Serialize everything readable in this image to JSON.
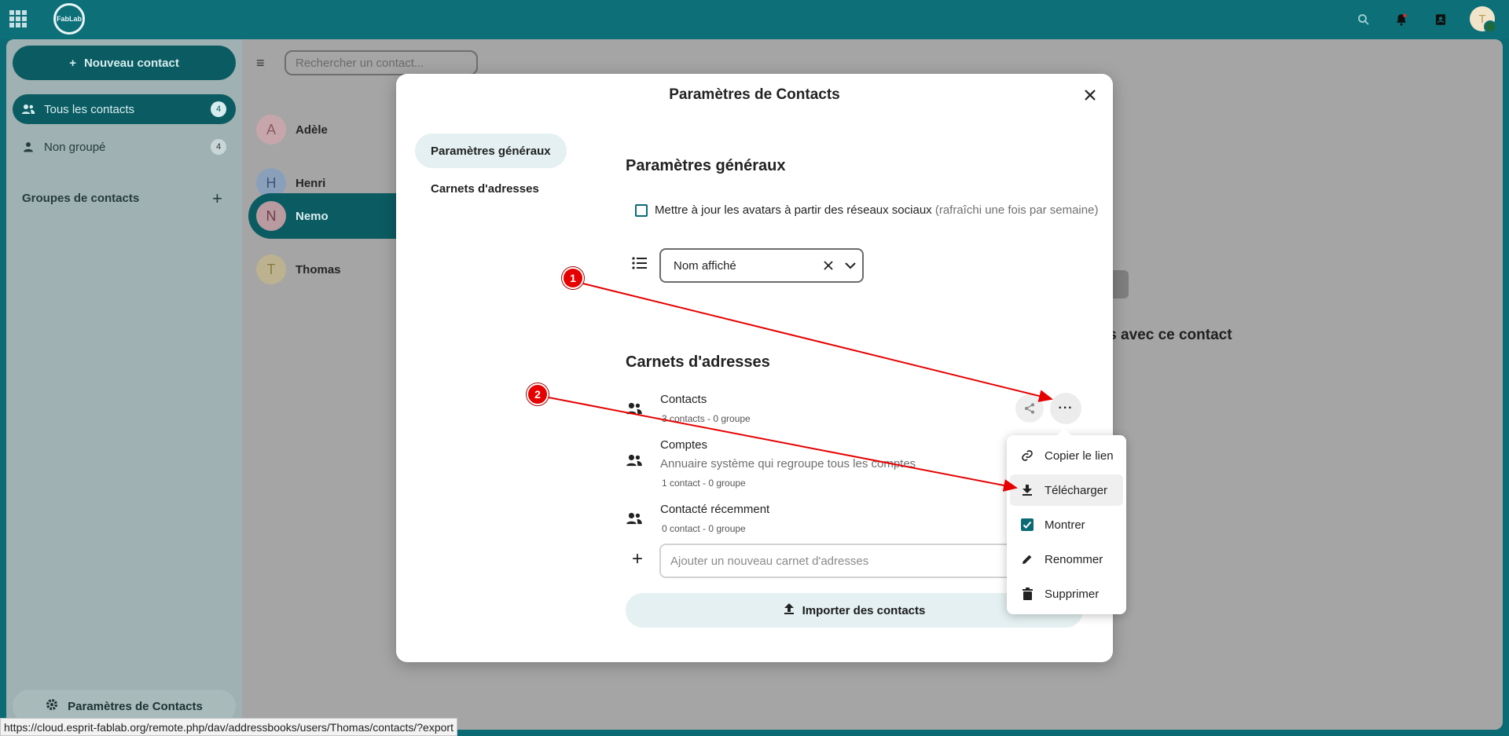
{
  "topbar": {
    "logo_text": "FabLab",
    "user_initial": "T",
    "icons": [
      "apps-icon",
      "search-icon",
      "notifications-icon",
      "contacts-icon"
    ]
  },
  "nav": {
    "new_contact_label": "Nouveau contact",
    "items": [
      {
        "label": "Tous les contacts",
        "count": "4",
        "active": true
      },
      {
        "label": "Non groupé",
        "count": "4",
        "active": false
      }
    ],
    "groups_heading": "Groupes de contacts",
    "footer_label": "Paramètres de Contacts"
  },
  "list": {
    "search_placeholder": "Rechercher un contact...",
    "contacts": [
      {
        "initial": "A",
        "name": "Adèle",
        "bg": "#d8b3b8",
        "fg": "#8b5a63"
      },
      {
        "initial": "H",
        "name": "Henri",
        "bg": "#8fa6c2",
        "fg": "#3d5576"
      },
      {
        "initial": "N",
        "name": "Nemo",
        "bg": "#c9a4ab",
        "fg": "#6c3d48",
        "active": true
      },
      {
        "initial": "T",
        "name": "Thomas",
        "bg": "#c7bb95",
        "fg": "#8b7a43"
      }
    ]
  },
  "detail": {
    "partial_text": "gés avec ce contact"
  },
  "modal": {
    "title": "Paramètres de Contacts",
    "nav": [
      "Paramètres généraux",
      "Carnets d'adresses"
    ],
    "general": {
      "heading": "Paramètres généraux",
      "checkbox_label": "Mettre à jour les avatars à partir des réseaux sociaux",
      "checkbox_hint": "(rafraîchi une fois par semaine)",
      "sort_value": "Nom affiché"
    },
    "addressbooks": {
      "heading": "Carnets d'adresses",
      "items": [
        {
          "name": "Contacts",
          "description": "",
          "meta": "3 contacts  - 0 groupe"
        },
        {
          "name": "Comptes",
          "description": "Annuaire système qui regroupe tous les comptes",
          "meta": "1 contact  - 0 groupe"
        },
        {
          "name": "Contacté récemment",
          "description": "",
          "meta": "0 contact  - 0 groupe"
        }
      ],
      "add_placeholder": "Ajouter un nouveau carnet d'adresses",
      "import_label": "Importer des contacts",
      "more_label": "···"
    }
  },
  "menu": {
    "items": [
      {
        "label": "Copier le lien",
        "icon": "link-icon"
      },
      {
        "label": "Télécharger",
        "icon": "download-icon",
        "hover": true
      },
      {
        "label": "Montrer",
        "icon": "checkbox-checked-icon"
      },
      {
        "label": "Renommer",
        "icon": "pencil-icon"
      },
      {
        "label": "Supprimer",
        "icon": "trash-icon"
      }
    ]
  },
  "annotations": {
    "badges": [
      "1",
      "2"
    ],
    "color": "#e60000"
  },
  "statusbar": {
    "url": "https://cloud.esprit-fablab.org/remote.php/dav/addressbooks/users/Thomas/contacts/?export"
  }
}
